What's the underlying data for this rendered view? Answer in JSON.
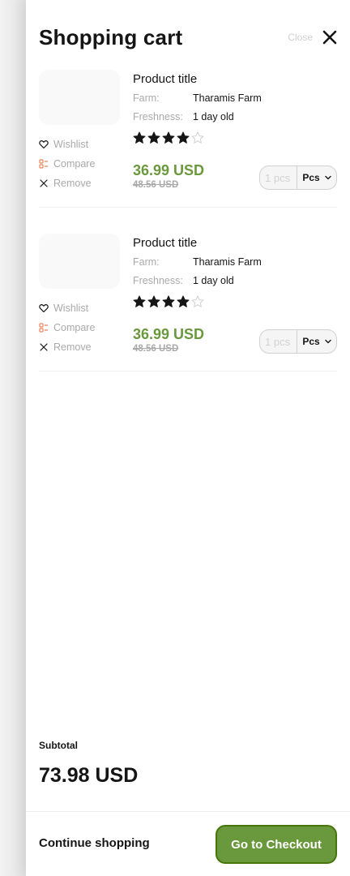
{
  "header": {
    "title": "Shopping cart",
    "close_label": "Close",
    "close_icon": "close-icon"
  },
  "cart": {
    "items": [
      {
        "title": "Product title",
        "farm_label": "Farm:",
        "farm_value": "Tharamis Farm",
        "freshness_label": "Freshness:",
        "freshness_value": "1 day old",
        "rating": 4,
        "rating_max": 5,
        "price": "36.99 USD",
        "old_price": "48.56 USD",
        "qty_placeholder": "1 pcs",
        "unit": "Pcs",
        "actions": {
          "wishlist": "Wishlist",
          "compare": "Compare",
          "remove": "Remove"
        }
      },
      {
        "title": "Product title",
        "farm_label": "Farm:",
        "farm_value": "Tharamis Farm",
        "freshness_label": "Freshness:",
        "freshness_value": "1 day old",
        "rating": 4,
        "rating_max": 5,
        "price": "36.99 USD",
        "old_price": "48.56 USD",
        "qty_placeholder": "1 pcs",
        "unit": "Pcs",
        "actions": {
          "wishlist": "Wishlist",
          "compare": "Compare",
          "remove": "Remove"
        }
      }
    ]
  },
  "summary": {
    "subtotal_label": "Subtotal",
    "subtotal_value": "73.98 USD"
  },
  "footer": {
    "continue_label": "Continue shopping",
    "checkout_label": "Go to Checkout"
  },
  "colors": {
    "accent": "#6a983c",
    "accent_border": "#46760a",
    "muted": "#a9a9a9",
    "compare_icon": "#e8845a"
  },
  "icons": [
    "heart-icon",
    "compare-icon",
    "remove-icon",
    "star-icon",
    "chevron-down-icon",
    "close-icon"
  ]
}
